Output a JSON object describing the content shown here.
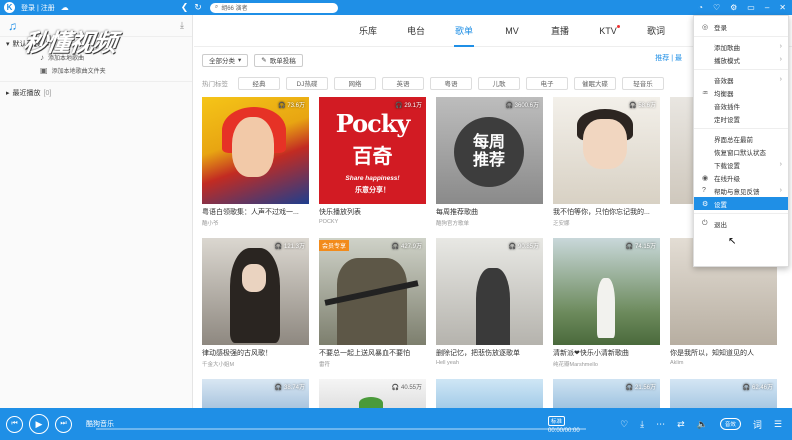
{
  "topbar": {
    "logo": "K",
    "login_label": "登录 | 注册",
    "search_value": "胡66 演者",
    "icons": [
      "cloud-icon",
      "back-icon",
      "refresh-icon",
      "search-icon",
      "skin-icon",
      "vip-icon",
      "settings-icon",
      "mini-mode-icon",
      "minimize-icon",
      "maximize-icon",
      "close-icon"
    ]
  },
  "watermark": "秒懂视频",
  "sidebar": {
    "music_icon": "♫",
    "default_list": {
      "label": "默认列表",
      "count": "[0]"
    },
    "items": [
      {
        "label": "添加本地歌曲"
      },
      {
        "label": "添加本地歌曲文件夹"
      }
    ],
    "recent": {
      "label": "最近播放",
      "count": "[0]"
    }
  },
  "tabs": [
    {
      "label": "乐库"
    },
    {
      "label": "电台"
    },
    {
      "label": "歌单",
      "active": true
    },
    {
      "label": "MV"
    },
    {
      "label": "直播"
    },
    {
      "label": "KTV",
      "dot": true
    },
    {
      "label": "歌词"
    }
  ],
  "filter": {
    "all_categories": "全部分类",
    "create_playlist": "歌单投稿",
    "sort_label": "推荐 | 最"
  },
  "tags": {
    "label": "热门标签",
    "items": [
      "经典",
      "DJ热碟",
      "网络",
      "英语",
      "粤语",
      "儿歌",
      "电子",
      "催眠大碟",
      "轻音乐"
    ]
  },
  "cards": [
    {
      "title": "粤语白领歌集：人声不过戏一...",
      "sub": "酷小爷",
      "plays": "73.6万"
    },
    {
      "title": "快乐播放列表",
      "sub": "POCKY",
      "plays": "29.1万",
      "cover_text": {
        "brand": "Pocky",
        "cn": "百奇",
        "slogan": "Share happiness!",
        "cn_slogan": "乐意分享！"
      }
    },
    {
      "title": "每周推荐歌曲",
      "sub": "酷狗官方歌单",
      "plays": "3600.6万",
      "cover_text": "每周推荐"
    },
    {
      "title": "我不怕等你，只怕你忘记我的...",
      "sub": "乏安娜",
      "plays": "58.6万"
    },
    {
      "title": "",
      "sub": "",
      "plays": ""
    },
    {
      "title": "律动感极强的古风歌！",
      "sub": "千金大小姐M",
      "plays": "121.3万"
    },
    {
      "title": "不要总一起上送风暴血不要怕",
      "sub": "雷符",
      "plays": "427.9万",
      "vip": "会员专享"
    },
    {
      "title": "删除记忆，把悲伤放逐歌单",
      "sub": "Hell yeah",
      "plays": "90.85万"
    },
    {
      "title": "清新派❤快乐小清新歌曲",
      "sub": "纯花瓣Marshmello",
      "plays": "74.15万"
    },
    {
      "title": "你是我所以，知知道见的人",
      "sub": "Aklim",
      "plays": ""
    },
    {
      "title": "",
      "sub": "",
      "plays": "38.74万"
    },
    {
      "title": "",
      "sub": "",
      "plays": "40.55万"
    },
    {
      "title": "",
      "sub": "",
      "plays": ""
    },
    {
      "title": "",
      "sub": "",
      "plays": "21.56万"
    },
    {
      "title": "",
      "sub": "",
      "plays": "62.46万"
    }
  ],
  "menu": {
    "items": [
      {
        "label": "登录",
        "icon": "user-icon",
        "glyph": "◎"
      },
      {
        "sep": true
      },
      {
        "label": "添加歌曲",
        "arrow": true
      },
      {
        "label": "播放模式",
        "arrow": true
      },
      {
        "sep": true
      },
      {
        "label": "音效器",
        "arrow": true
      },
      {
        "label": "均衡器",
        "icon": "equalizer-icon",
        "glyph": "♒"
      },
      {
        "label": "音效插件"
      },
      {
        "label": "定时设置"
      },
      {
        "sep": true
      },
      {
        "label": "界面总在最前"
      },
      {
        "label": "恢复窗口默认状态"
      },
      {
        "label": "下载设置",
        "arrow": true
      },
      {
        "label": "在线升级",
        "icon": "update-icon",
        "glyph": "◉"
      },
      {
        "label": "帮助与意见反馈",
        "icon": "help-icon",
        "glyph": "?",
        "arrow": true
      },
      {
        "label": "设置",
        "icon": "settings-icon",
        "glyph": "⚙",
        "highlight": true
      },
      {
        "sep": true
      },
      {
        "label": "退出",
        "icon": "power-icon",
        "glyph": "⏻"
      }
    ]
  },
  "player": {
    "song": "酷狗音乐",
    "quality": "标准",
    "time": "00:00/00:00",
    "progress": 0,
    "sound_effect": "音效"
  },
  "colors": {
    "brand": "#1f8fe6",
    "vip": "#f28b1b"
  }
}
